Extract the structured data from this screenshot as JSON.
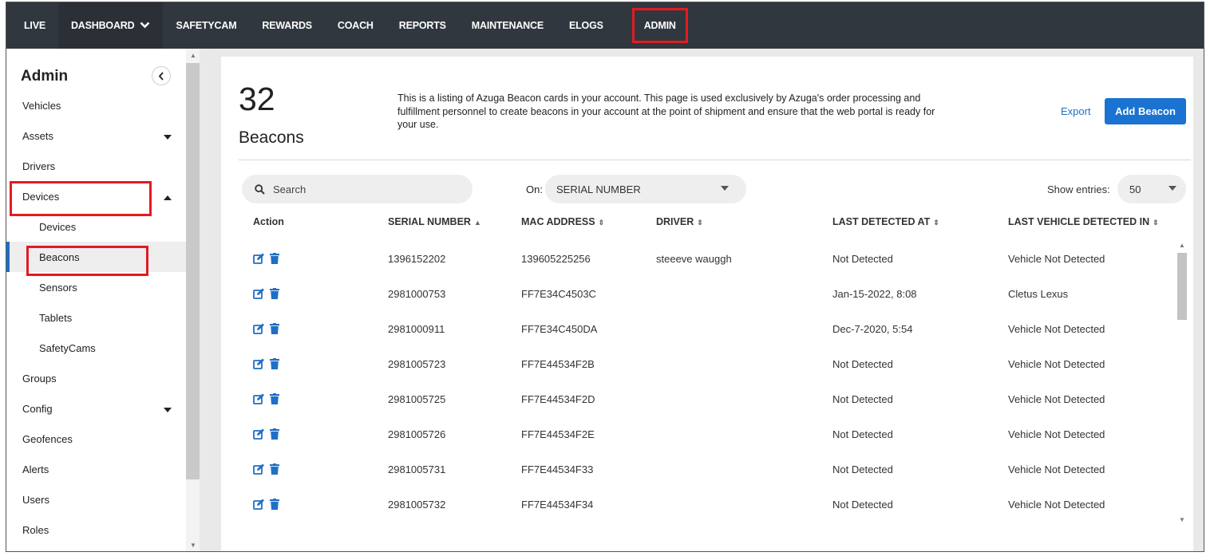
{
  "topnav": {
    "items": [
      {
        "label": "LIVE"
      },
      {
        "label": "DASHBOARD"
      },
      {
        "label": "SAFETYCAM"
      },
      {
        "label": "REWARDS"
      },
      {
        "label": "COACH"
      },
      {
        "label": "REPORTS"
      },
      {
        "label": "MAINTENANCE"
      },
      {
        "label": "ELOGS"
      },
      {
        "label": "ADMIN"
      }
    ]
  },
  "sidebar": {
    "title": "Admin",
    "items": [
      {
        "label": "Vehicles"
      },
      {
        "label": "Assets"
      },
      {
        "label": "Drivers"
      },
      {
        "label": "Devices"
      },
      {
        "label": "Devices"
      },
      {
        "label": "Beacons"
      },
      {
        "label": "Sensors"
      },
      {
        "label": "Tablets"
      },
      {
        "label": "SafetyCams"
      },
      {
        "label": "Groups"
      },
      {
        "label": "Config"
      },
      {
        "label": "Geofences"
      },
      {
        "label": "Alerts"
      },
      {
        "label": "Users"
      },
      {
        "label": "Roles"
      }
    ]
  },
  "header": {
    "count": "32",
    "count_label": "Beacons",
    "description": "This is a listing of Azuga Beacon cards in your account. This page is used exclusively by Azuga's order processing and fulfillment personnel to create beacons in your account at the point of shipment and ensure that the web portal is ready for your use.",
    "export_label": "Export",
    "add_label": "Add Beacon"
  },
  "filters": {
    "search_placeholder": "Search",
    "on_label": "On:",
    "on_value": "SERIAL NUMBER",
    "show_label": "Show entries:",
    "show_value": "50"
  },
  "table": {
    "columns": [
      "Action",
      "SERIAL NUMBER",
      "MAC ADDRESS",
      "DRIVER",
      "LAST DETECTED AT",
      "LAST VEHICLE DETECTED IN"
    ],
    "rows": [
      {
        "serial": "1396152202",
        "mac": "139605225256",
        "driver": "steeeve wauggh",
        "detected": "Not Detected",
        "vehicle": "Vehicle Not Detected"
      },
      {
        "serial": "2981000753",
        "mac": "FF7E34C4503C",
        "driver": "",
        "detected": "Jan-15-2022, 8:08",
        "vehicle": "Cletus Lexus"
      },
      {
        "serial": "2981000911",
        "mac": "FF7E34C450DA",
        "driver": "",
        "detected": "Dec-7-2020, 5:54",
        "vehicle": "Vehicle Not Detected"
      },
      {
        "serial": "2981005723",
        "mac": "FF7E44534F2B",
        "driver": "",
        "detected": "Not Detected",
        "vehicle": "Vehicle Not Detected"
      },
      {
        "serial": "2981005725",
        "mac": "FF7E44534F2D",
        "driver": "",
        "detected": "Not Detected",
        "vehicle": "Vehicle Not Detected"
      },
      {
        "serial": "2981005726",
        "mac": "FF7E44534F2E",
        "driver": "",
        "detected": "Not Detected",
        "vehicle": "Vehicle Not Detected"
      },
      {
        "serial": "2981005731",
        "mac": "FF7E44534F33",
        "driver": "",
        "detected": "Not Detected",
        "vehicle": "Vehicle Not Detected"
      },
      {
        "serial": "2981005732",
        "mac": "FF7E44534F34",
        "driver": "",
        "detected": "Not Detected",
        "vehicle": "Vehicle Not Detected"
      }
    ]
  },
  "colors": {
    "nav_bg": "#31373e",
    "accent_blue": "#1a73d0",
    "highlight_red": "#e21b23"
  },
  "icons": {
    "edit": "edit-icon",
    "delete": "trash-icon",
    "sort": "sort-icon",
    "collapse": "chevron-left-icon"
  }
}
